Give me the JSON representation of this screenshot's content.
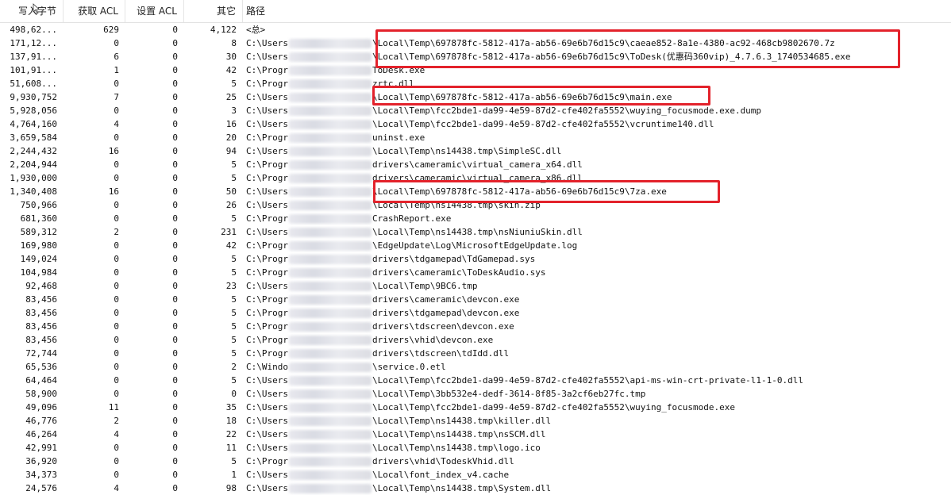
{
  "header": {
    "write_bytes": "写入字节",
    "get_acl": "获取 ACL",
    "set_acl": "设置 ACL",
    "other": "其它",
    "path": "路径"
  },
  "highlight_color": "#e3222b",
  "rows": [
    {
      "write": "498,62...",
      "get": "629",
      "set": "0",
      "other": "4,122",
      "prefix": "<总>",
      "blur": false,
      "suffix": ""
    },
    {
      "write": "171,12...",
      "get": "0",
      "set": "0",
      "other": "8",
      "prefix": "C:\\Users",
      "blur": true,
      "suffix": "\\Local\\Temp\\697878fc-5812-417a-ab56-69e6b76d15c9\\caeae852-8a1e-4380-ac92-468cb9802670.7z"
    },
    {
      "write": "137,91...",
      "get": "6",
      "set": "0",
      "other": "30",
      "prefix": "C:\\Users",
      "blur": true,
      "suffix": "\\Local\\Temp\\697878fc-5812-417a-ab56-69e6b76d15c9\\ToDesk(优惠码360vip)_4.7.6.3_1740534685.exe"
    },
    {
      "write": "101,91...",
      "get": "1",
      "set": "0",
      "other": "42",
      "prefix": "C:\\Progr",
      "blur": true,
      "suffix": "ToDesk.exe"
    },
    {
      "write": "51,608...",
      "get": "0",
      "set": "0",
      "other": "5",
      "prefix": "C:\\Progr",
      "blur": true,
      "suffix": "zrtc.dll"
    },
    {
      "write": "9,930,752",
      "get": "7",
      "set": "0",
      "other": "25",
      "prefix": "C:\\Users",
      "blur": true,
      "suffix": "\\Local\\Temp\\697878fc-5812-417a-ab56-69e6b76d15c9\\main.exe"
    },
    {
      "write": "5,928,056",
      "get": "0",
      "set": "0",
      "other": "3",
      "prefix": "C:\\Users",
      "blur": true,
      "suffix": "\\Local\\Temp\\fcc2bde1-da99-4e59-87d2-cfe402fa5552\\wuying_focusmode.exe.dump"
    },
    {
      "write": "4,764,160",
      "get": "4",
      "set": "0",
      "other": "16",
      "prefix": "C:\\Users",
      "blur": true,
      "suffix": "\\Local\\Temp\\fcc2bde1-da99-4e59-87d2-cfe402fa5552\\vcruntime140.dll"
    },
    {
      "write": "3,659,584",
      "get": "0",
      "set": "0",
      "other": "20",
      "prefix": "C:\\Progr",
      "blur": true,
      "suffix": "uninst.exe"
    },
    {
      "write": "2,244,432",
      "get": "16",
      "set": "0",
      "other": "94",
      "prefix": "C:\\Users",
      "blur": true,
      "suffix": "\\Local\\Temp\\ns14438.tmp\\SimpleSC.dll"
    },
    {
      "write": "2,204,944",
      "get": "0",
      "set": "0",
      "other": "5",
      "prefix": "C:\\Progr",
      "blur": true,
      "suffix": "drivers\\cameramic\\virtual_camera_x64.dll"
    },
    {
      "write": "1,930,000",
      "get": "0",
      "set": "0",
      "other": "5",
      "prefix": "C:\\Progr",
      "blur": true,
      "suffix": "drivers\\cameramic\\virtual_camera_x86.dll"
    },
    {
      "write": "1,340,408",
      "get": "16",
      "set": "0",
      "other": "50",
      "prefix": "C:\\Users",
      "blur": true,
      "suffix": "\\Local\\Temp\\697878fc-5812-417a-ab56-69e6b76d15c9\\7za.exe"
    },
    {
      "write": "750,966",
      "get": "0",
      "set": "0",
      "other": "26",
      "prefix": "C:\\Users",
      "blur": true,
      "suffix": "\\Local\\Temp\\ns14438.tmp\\skin.zip"
    },
    {
      "write": "681,360",
      "get": "0",
      "set": "0",
      "other": "5",
      "prefix": "C:\\Progr",
      "blur": true,
      "suffix": "CrashReport.exe"
    },
    {
      "write": "589,312",
      "get": "2",
      "set": "0",
      "other": "231",
      "prefix": "C:\\Users",
      "blur": true,
      "suffix": "\\Local\\Temp\\ns14438.tmp\\nsNiuniuSkin.dll"
    },
    {
      "write": "169,980",
      "get": "0",
      "set": "0",
      "other": "42",
      "prefix": "C:\\Progr",
      "blur": true,
      "suffix": "\\EdgeUpdate\\Log\\MicrosoftEdgeUpdate.log"
    },
    {
      "write": "149,024",
      "get": "0",
      "set": "0",
      "other": "5",
      "prefix": "C:\\Progr",
      "blur": true,
      "suffix": "drivers\\tdgamepad\\TdGamepad.sys"
    },
    {
      "write": "104,984",
      "get": "0",
      "set": "0",
      "other": "5",
      "prefix": "C:\\Progr",
      "blur": true,
      "suffix": "drivers\\cameramic\\ToDeskAudio.sys"
    },
    {
      "write": "92,468",
      "get": "0",
      "set": "0",
      "other": "23",
      "prefix": "C:\\Users",
      "blur": true,
      "suffix": "\\Local\\Temp\\9BC6.tmp"
    },
    {
      "write": "83,456",
      "get": "0",
      "set": "0",
      "other": "5",
      "prefix": "C:\\Progr",
      "blur": true,
      "suffix": "drivers\\cameramic\\devcon.exe"
    },
    {
      "write": "83,456",
      "get": "0",
      "set": "0",
      "other": "5",
      "prefix": "C:\\Progr",
      "blur": true,
      "suffix": "drivers\\tdgamepad\\devcon.exe"
    },
    {
      "write": "83,456",
      "get": "0",
      "set": "0",
      "other": "5",
      "prefix": "C:\\Progr",
      "blur": true,
      "suffix": "drivers\\tdscreen\\devcon.exe"
    },
    {
      "write": "83,456",
      "get": "0",
      "set": "0",
      "other": "5",
      "prefix": "C:\\Progr",
      "blur": true,
      "suffix": "drivers\\vhid\\devcon.exe"
    },
    {
      "write": "72,744",
      "get": "0",
      "set": "0",
      "other": "5",
      "prefix": "C:\\Progr",
      "blur": true,
      "suffix": "drivers\\tdscreen\\tdIdd.dll"
    },
    {
      "write": "65,536",
      "get": "0",
      "set": "0",
      "other": "2",
      "prefix": "C:\\Windo",
      "blur": true,
      "suffix": "\\service.0.etl"
    },
    {
      "write": "64,464",
      "get": "0",
      "set": "0",
      "other": "5",
      "prefix": "C:\\Users",
      "blur": true,
      "suffix": "\\Local\\Temp\\fcc2bde1-da99-4e59-87d2-cfe402fa5552\\api-ms-win-crt-private-l1-1-0.dll"
    },
    {
      "write": "58,900",
      "get": "0",
      "set": "0",
      "other": "0",
      "prefix": "C:\\Users",
      "blur": true,
      "suffix": "\\Local\\Temp\\3bb532e4-dedf-3614-8f85-3a2cf6eb27fc.tmp"
    },
    {
      "write": "49,096",
      "get": "11",
      "set": "0",
      "other": "35",
      "prefix": "C:\\Users",
      "blur": true,
      "suffix": "\\Local\\Temp\\fcc2bde1-da99-4e59-87d2-cfe402fa5552\\wuying_focusmode.exe"
    },
    {
      "write": "46,776",
      "get": "2",
      "set": "0",
      "other": "18",
      "prefix": "C:\\Users",
      "blur": true,
      "suffix": "\\Local\\Temp\\ns14438.tmp\\killer.dll"
    },
    {
      "write": "46,264",
      "get": "4",
      "set": "0",
      "other": "22",
      "prefix": "C:\\Users",
      "blur": true,
      "suffix": "\\Local\\Temp\\ns14438.tmp\\nsSCM.dll"
    },
    {
      "write": "42,991",
      "get": "0",
      "set": "0",
      "other": "11",
      "prefix": "C:\\Users",
      "blur": true,
      "suffix": "\\Local\\Temp\\ns14438.tmp\\logo.ico"
    },
    {
      "write": "36,920",
      "get": "0",
      "set": "0",
      "other": "5",
      "prefix": "C:\\Progr",
      "blur": true,
      "suffix": "drivers\\vhid\\TodeskVhid.dll"
    },
    {
      "write": "34,373",
      "get": "0",
      "set": "0",
      "other": "1",
      "prefix": "C:\\Users",
      "blur": true,
      "suffix": "\\Local\\font_index_v4.cache"
    },
    {
      "write": "24,576",
      "get": "4",
      "set": "0",
      "other": "98",
      "prefix": "C:\\Users",
      "blur": true,
      "suffix": "\\Local\\Temp\\ns14438.tmp\\System.dll"
    }
  ]
}
